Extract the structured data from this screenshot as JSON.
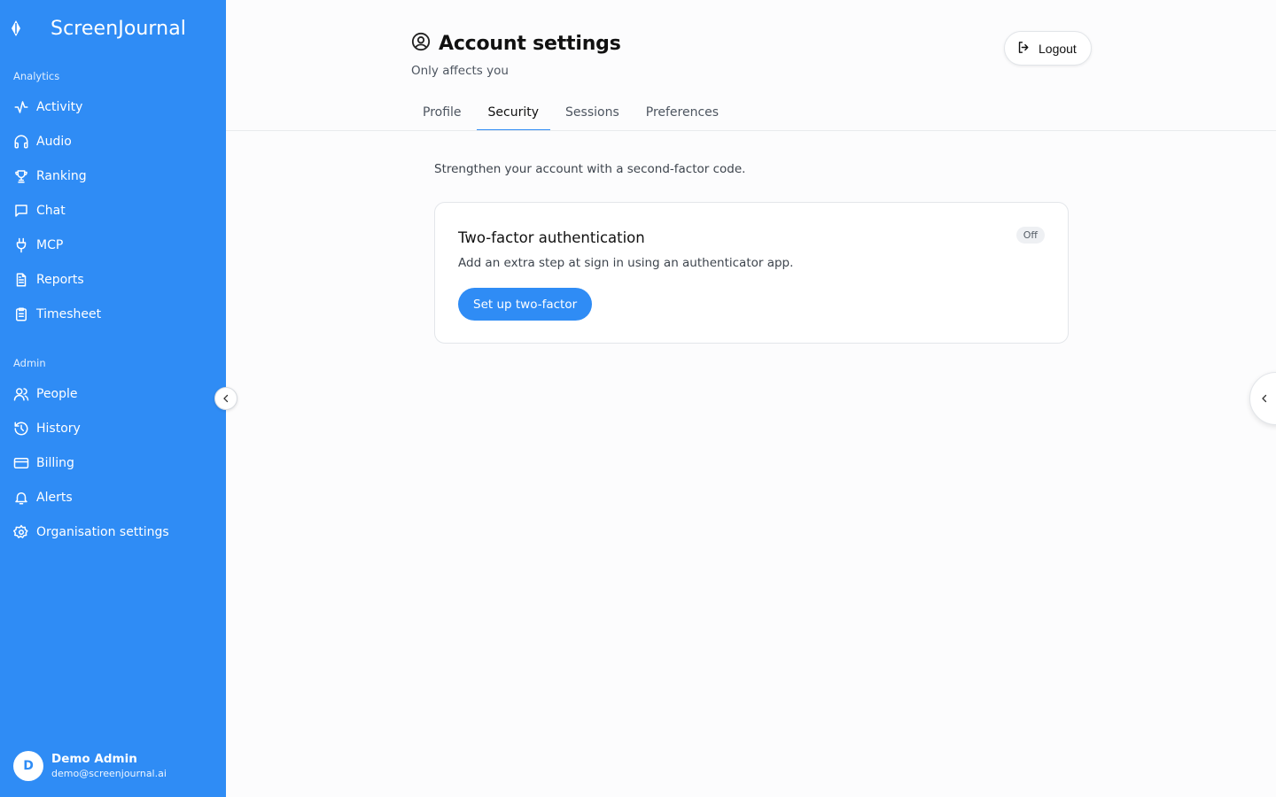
{
  "app": {
    "name": "ScreenJournal"
  },
  "sidebar": {
    "analytics_label": "Analytics",
    "analytics_items": [
      {
        "label": "Activity",
        "icon": "activity-icon"
      },
      {
        "label": "Audio",
        "icon": "headphones-icon"
      },
      {
        "label": "Ranking",
        "icon": "trophy-icon"
      },
      {
        "label": "Chat",
        "icon": "chat-icon"
      },
      {
        "label": "MCP",
        "icon": "plug-icon"
      },
      {
        "label": "Reports",
        "icon": "document-icon"
      },
      {
        "label": "Timesheet",
        "icon": "clipboard-icon"
      }
    ],
    "admin_label": "Admin",
    "admin_items": [
      {
        "label": "People",
        "icon": "users-icon"
      },
      {
        "label": "History",
        "icon": "history-icon"
      },
      {
        "label": "Billing",
        "icon": "credit-card-icon"
      },
      {
        "label": "Alerts",
        "icon": "bell-icon"
      },
      {
        "label": "Organisation settings",
        "icon": "gear-icon"
      }
    ],
    "user": {
      "initial": "D",
      "name": "Demo Admin",
      "email": "demo@screenjournal.ai"
    }
  },
  "header": {
    "title": "Account settings",
    "subtitle": "Only affects you",
    "logout_label": "Logout"
  },
  "tabs": [
    {
      "label": "Profile",
      "active": false
    },
    {
      "label": "Security",
      "active": true
    },
    {
      "label": "Sessions",
      "active": false
    },
    {
      "label": "Preferences",
      "active": false
    }
  ],
  "security": {
    "intro": "Strengthen your account with a second-factor code.",
    "two_factor": {
      "title": "Two-factor authentication",
      "description": "Add an extra step at sign in using an authenticator app.",
      "status": "Off",
      "button_label": "Set up two-factor"
    }
  },
  "colors": {
    "accent": "#2f8cf5",
    "sidebar_bg": "#2f8cf5"
  }
}
